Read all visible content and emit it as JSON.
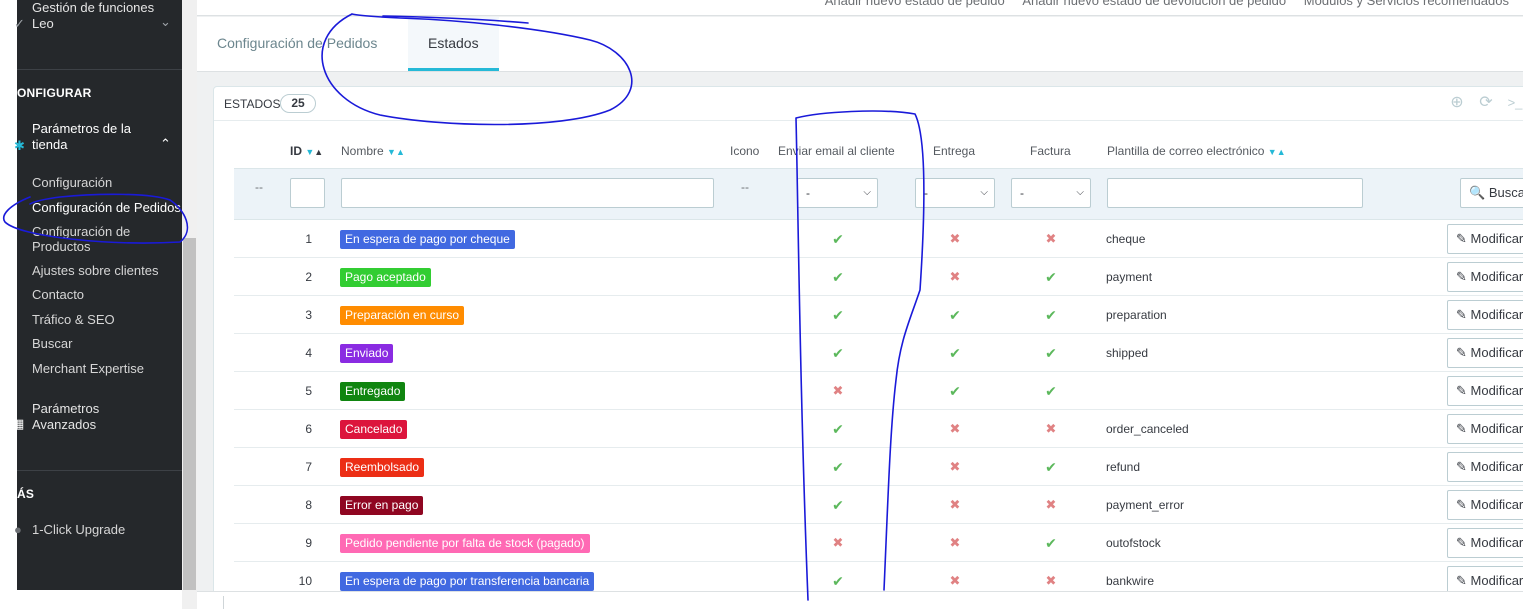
{
  "sidebar": {
    "leo_label_line1": "Gestión de funciones",
    "leo_label_line2": "Leo",
    "section_configure": "ONFIGURAR",
    "shop_params_line1": "Parámetros de la",
    "shop_params_line2": "tienda",
    "items": [
      {
        "label": "Configuración"
      },
      {
        "label": "Configuración de Pedidos"
      },
      {
        "label": "Configuración de"
      },
      {
        "label": "Productos"
      },
      {
        "label": "Ajustes sobre clientes"
      },
      {
        "label": "Contacto"
      },
      {
        "label": "Tráfico & SEO"
      },
      {
        "label": "Buscar"
      },
      {
        "label": "Merchant Expertise"
      }
    ],
    "advanced_line1": "Parámetros",
    "advanced_line2": "Avanzados",
    "section_more": "ÁS",
    "upgrade": "1-Click Upgrade"
  },
  "header": {
    "links": [
      "Añadir nuevo estado de pedido",
      "Añadir nuevo estado de devolución de pedido",
      "Módulos y Servicios recomendados"
    ]
  },
  "tabs": [
    {
      "label": "Configuración de Pedidos"
    },
    {
      "label": "Estados"
    }
  ],
  "panel": {
    "title": "ESTADOS",
    "count": "25"
  },
  "table": {
    "headers": {
      "id": "ID",
      "name": "Nombre",
      "icon": "Icono",
      "send_email": "Enviar email al cliente",
      "delivery": "Entrega",
      "invoice": "Factura",
      "template": "Plantilla de correo electrónico"
    },
    "filter": {
      "dash": "--",
      "select_value": "-",
      "search_button": "Buscar"
    },
    "edit_label": "Modificar",
    "rows": [
      {
        "id": "1",
        "name": "En espera de pago por cheque",
        "color": "#4169e1",
        "email": true,
        "delivery": false,
        "invoice": false,
        "template": "cheque"
      },
      {
        "id": "2",
        "name": "Pago aceptado",
        "color": "#32cd32",
        "email": true,
        "delivery": false,
        "invoice": true,
        "template": "payment"
      },
      {
        "id": "3",
        "name": "Preparación en curso",
        "color": "#ff8c00",
        "email": true,
        "delivery": true,
        "invoice": true,
        "template": "preparation"
      },
      {
        "id": "4",
        "name": "Enviado",
        "color": "#8a2be2",
        "email": true,
        "delivery": true,
        "invoice": true,
        "template": "shipped"
      },
      {
        "id": "5",
        "name": "Entregado",
        "color": "#108510",
        "email": false,
        "delivery": true,
        "invoice": true,
        "template": ""
      },
      {
        "id": "6",
        "name": "Cancelado",
        "color": "#dc143c",
        "email": true,
        "delivery": false,
        "invoice": false,
        "template": "order_canceled"
      },
      {
        "id": "7",
        "name": "Reembolsado",
        "color": "#ec2e15",
        "email": true,
        "delivery": false,
        "invoice": true,
        "template": "refund"
      },
      {
        "id": "8",
        "name": "Error en pago",
        "color": "#8f0621",
        "email": true,
        "delivery": false,
        "invoice": false,
        "template": "payment_error"
      },
      {
        "id": "9",
        "name": "Pedido pendiente por falta de stock (pagado)",
        "color": "#ff69b4",
        "email": false,
        "delivery": false,
        "invoice": true,
        "template": "outofstock"
      },
      {
        "id": "10",
        "name": "En espera de pago por transferencia bancaria",
        "color": "#4169e1",
        "email": true,
        "delivery": false,
        "invoice": false,
        "template": "bankwire"
      }
    ]
  },
  "colors": {
    "accent": "#25b9d7",
    "sidebar_bg": "#25282b",
    "check": "#5cb85c",
    "cross": "#e08283",
    "ink": "#1a1ad9"
  }
}
